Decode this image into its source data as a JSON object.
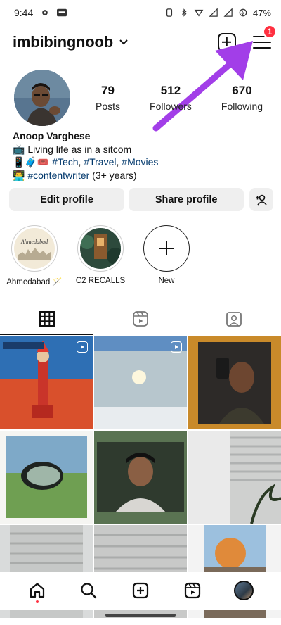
{
  "status_bar": {
    "time": "9:44",
    "battery": "47%",
    "icons": [
      "gear-icon",
      "notification-icon",
      "mute-icon",
      "bluetooth-icon",
      "wifi-icon",
      "signal-icon",
      "battery-icon"
    ]
  },
  "header": {
    "username": "imbibingnoob",
    "username_chevron": "⌄",
    "menu_badge": "1"
  },
  "profile": {
    "stats": [
      {
        "value": "79",
        "label": "Posts"
      },
      {
        "value": "512",
        "label": "Followers"
      },
      {
        "value": "670",
        "label": "Following"
      }
    ],
    "bio": {
      "name": "Anoop Varghese",
      "line1": "📺 Living life as in a sitcom",
      "line2_prefix": "📱🧳🎟️ ",
      "line2_tags": [
        "#Tech",
        "#Travel",
        "#Movies"
      ],
      "line3_prefix": "👨‍💻 ",
      "line3_tag": "#contentwriter",
      "line3_suffix": " (3+ years)"
    }
  },
  "actions": {
    "edit_profile": "Edit profile",
    "share_profile": "Share profile"
  },
  "highlights": [
    {
      "label": "Ahmedabad 🪄",
      "cover_text": "Ahmedabad"
    },
    {
      "label": "C2 RECALLS"
    },
    {
      "label": "New"
    }
  ],
  "tabs": [
    "posts-grid",
    "reels",
    "tagged"
  ],
  "colors": {
    "badge": "#ff3040",
    "hashtag": "#00376b",
    "arrow": "#a23ee8",
    "button_bg": "#efefef"
  }
}
